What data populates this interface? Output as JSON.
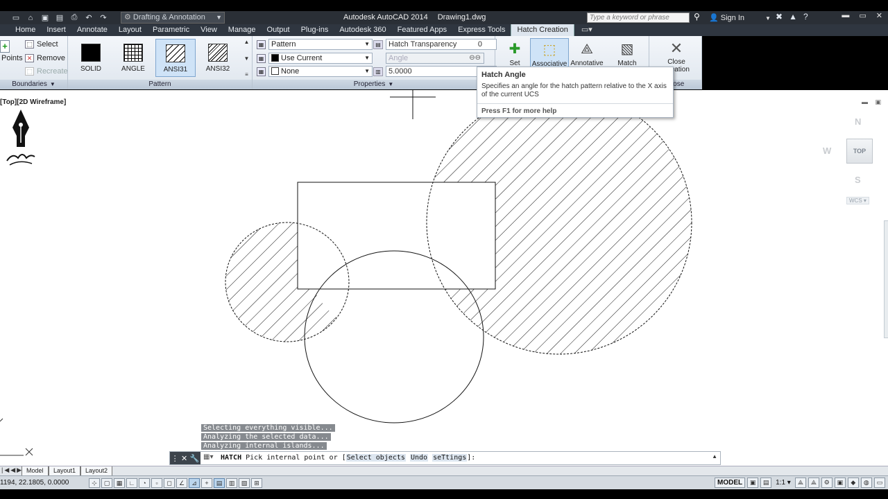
{
  "title_bar": {
    "workspace": "Drafting & Annotation",
    "app_name": "Autodesk AutoCAD 2014",
    "document": "Drawing1.dwg",
    "search_placeholder": "Type a keyword or phrase",
    "sign_in": "Sign In"
  },
  "tabs": [
    "Home",
    "Insert",
    "Annotate",
    "Layout",
    "Parametric",
    "View",
    "Manage",
    "Output",
    "Plug-ins",
    "Autodesk 360",
    "Featured Apps",
    "Express Tools",
    "Hatch Creation"
  ],
  "active_tab": "Hatch Creation",
  "ribbon": {
    "boundaries": {
      "pick_points": "Points",
      "select": "Select",
      "remove": "Remove",
      "recreate": "Recreate",
      "title": "Boundaries"
    },
    "pattern": {
      "title": "Pattern",
      "swatches": [
        "SOLID",
        "ANGLE",
        "ANSI31",
        "ANSI32"
      ],
      "selected": "ANSI31"
    },
    "properties": {
      "title": "Properties",
      "hatch_type": "Pattern",
      "hatch_color": "Use Current",
      "background_color": "None",
      "transparency_label": "Hatch Transparency",
      "transparency_value": "0",
      "angle_label": "Angle",
      "scale_value": "5.0000"
    },
    "options": {
      "set_origin": "Set",
      "associative": "Associative",
      "annotative": "Annotative",
      "match_properties": "Match"
    },
    "close": {
      "line1": "Close",
      "line2": "Creation",
      "title": "Close"
    }
  },
  "tooltip": {
    "title": "Hatch Angle",
    "description": "Specifies an angle for the hatch pattern relative to the X axis of the current UCS",
    "help": "Press F1 for more help"
  },
  "viewport": {
    "label": "[Top][2D Wireframe]",
    "viewcube": {
      "north": "N",
      "south": "S",
      "west": "W",
      "face": "TOP",
      "wcs": "WCS"
    }
  },
  "command": {
    "history": [
      "Selecting everything visible...",
      "Analyzing the selected data...",
      "Analyzing internal islands..."
    ],
    "command_name": "HATCH",
    "prompt": "Pick internal point or [",
    "options": [
      "Select objects",
      "Undo",
      "seTtings"
    ],
    "prompt_end": "]:"
  },
  "layout_tabs": [
    "Model",
    "Layout1",
    "Layout2"
  ],
  "status_bar": {
    "coords": "1194, 22.1805, 0.0000",
    "space": "MODEL",
    "annotation_scale": "1:1"
  },
  "colors": {
    "titlebar": "#2a2f36",
    "ribbon_active_tab": "#dde5ee",
    "selected_button": "#cfe3f7",
    "canvas": "#ffffff"
  }
}
